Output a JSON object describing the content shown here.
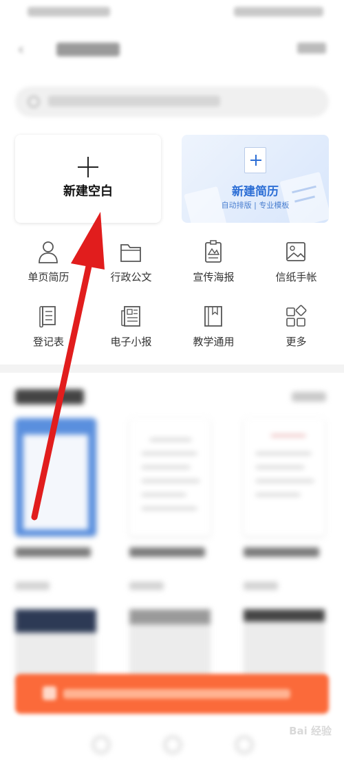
{
  "status_bar": {},
  "top_bar": {
    "back_icon": "back-arrow-icon"
  },
  "search": {},
  "cards": {
    "blank": {
      "label": "新建空白",
      "icon": "plus-icon"
    },
    "resume": {
      "title": "新建简历",
      "subtitle": "自动排版 | 专业模板",
      "icon": "plus-doc-icon",
      "accent": "#2c6ed5"
    }
  },
  "categories": [
    {
      "label": "单页简历",
      "icon": "person-icon"
    },
    {
      "label": "行政公文",
      "icon": "folder-icon"
    },
    {
      "label": "宣传海报",
      "icon": "poster-icon"
    },
    {
      "label": "信纸手帐",
      "icon": "image-icon"
    },
    {
      "label": "登记表",
      "icon": "scroll-icon"
    },
    {
      "label": "电子小报",
      "icon": "newspaper-icon"
    },
    {
      "label": "教学通用",
      "icon": "book-icon"
    },
    {
      "label": "更多",
      "icon": "grid-icon"
    }
  ],
  "promo": {
    "color": "#fb6a3a"
  },
  "annotation": {
    "arrow_color": "#e11d1d"
  },
  "watermark": {
    "text": "Bai 经验"
  }
}
